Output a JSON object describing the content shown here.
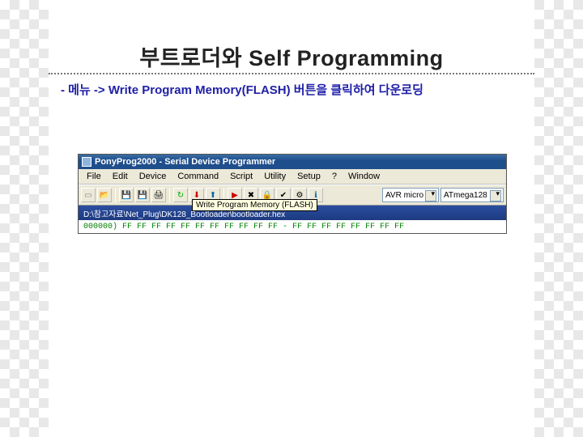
{
  "slide": {
    "title": "부트로더와 Self Programming",
    "subtitle": "- 메뉴 -> Write Program Memory(FLASH) 버튼을 클릭하여 다운로딩"
  },
  "app": {
    "window_title": "PonyProg2000 - Serial Device Programmer",
    "menu": {
      "file": "File",
      "edit": "Edit",
      "device": "Device",
      "command": "Command",
      "script": "Script",
      "utility": "Utility",
      "setup": "Setup",
      "help": "?",
      "window": "Window"
    },
    "toolbar": {
      "device_family": "AVR micro",
      "device_type": "ATmega128"
    },
    "tooltip": "Write Program Memory (FLASH)",
    "pathbar_prefix": "D:\\참고자료\\Net_Plug\\DK128_Bootloader\\bootloader.hex",
    "hex": {
      "offset": "000000)",
      "bytes": "FF FF FF FF FF FF FF FF FF FF FF - FF FF FF FF FF FF FF FF"
    }
  }
}
